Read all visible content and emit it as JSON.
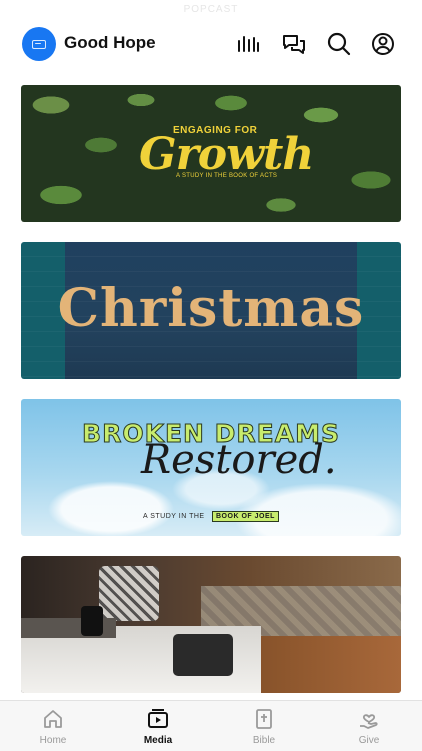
{
  "status": {
    "faded_text": "POPCAST"
  },
  "header": {
    "title": "Good Hope",
    "logo_icon": "church-logo-icon",
    "icons": [
      "audio-bars-icon",
      "chat-icon",
      "search-icon",
      "profile-icon"
    ]
  },
  "media": {
    "cards": [
      {
        "kicker": "ENGAGING FOR",
        "title": "Growth",
        "subtitle": "A STUDY IN THE BOOK OF ACTS",
        "accent": "#f0d23a"
      },
      {
        "title": "Christmas",
        "accent": "#e3b478"
      },
      {
        "kicker": "BROKEN DREAMS",
        "title": "Restored.",
        "subtitle": "A STUDY IN THE",
        "subtitle_box": "BOOK OF JOEL",
        "accent": "#c8ec6e"
      },
      {
        "title": ""
      }
    ]
  },
  "tabbar": {
    "tabs": [
      {
        "label": "Home",
        "icon": "home-icon",
        "active": false
      },
      {
        "label": "Media",
        "icon": "media-play-icon",
        "active": true
      },
      {
        "label": "Bible",
        "icon": "bible-icon",
        "active": false
      },
      {
        "label": "Give",
        "icon": "give-heart-hand-icon",
        "active": false
      }
    ]
  },
  "colors": {
    "brand": "#1877f2",
    "active_tab": "#111111",
    "inactive_tab": "#9a9a9a"
  }
}
